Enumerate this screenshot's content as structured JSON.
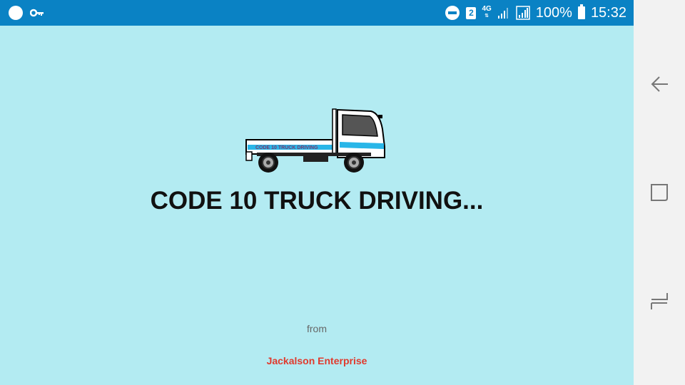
{
  "status_bar": {
    "sim_slot": "2",
    "network_type": "4G",
    "battery": "100%",
    "time": "15:32",
    "icons": [
      "circle-notification-icon",
      "key-icon",
      "do-not-disturb-icon",
      "sim-icon",
      "signal-icon",
      "signal-icon",
      "battery-icon"
    ]
  },
  "splash": {
    "logo_text": "CODE 10 TRUCK DRIVING",
    "title": "CODE 10 TRUCK DRIVING...",
    "from_label": "from",
    "company": "Jackalson Enterprise"
  },
  "nav_bar": {
    "buttons": [
      "back-icon",
      "recents-icon",
      "home-icon"
    ]
  },
  "colors": {
    "status_bar": "#0a82c4",
    "background": "#b3ebf2",
    "nav_bar": "#f2f2f2",
    "company_text": "#e03a2d",
    "truck_stripe": "#29b6e8"
  }
}
